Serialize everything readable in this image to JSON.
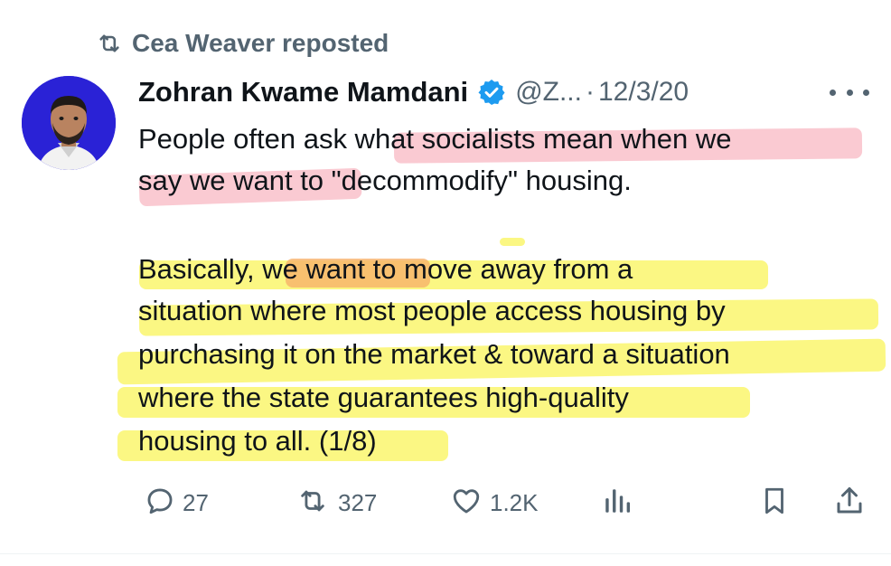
{
  "repost": {
    "label": "Cea Weaver reposted",
    "icon": "repost-icon"
  },
  "author": {
    "name": "Zohran Kwame Mamdani",
    "handle": "@Z...",
    "separator": "·",
    "date": "12/3/20",
    "verified_icon": "verified-badge-icon",
    "avatar_bg": "#2a22d6"
  },
  "tweet": {
    "lines": [
      "People often ask what socialists mean when we",
      "say we want to \"decommodify\" housing.",
      "Basically, we want to move away from a",
      "situation where most people access housing by",
      "purchasing it on the market & toward a situation",
      "where the state guarantees high-quality",
      "housing to all. (1/8)"
    ]
  },
  "actions": {
    "replies": "27",
    "reposts": "327",
    "likes": "1.2K"
  },
  "colors": {
    "text": "#0f1419",
    "muted": "#536471",
    "verified": "#1d9bf0",
    "highlight_red": "#f696a5",
    "highlight_yellow": "#faf45a",
    "highlight_orange": "#f8b26a"
  }
}
